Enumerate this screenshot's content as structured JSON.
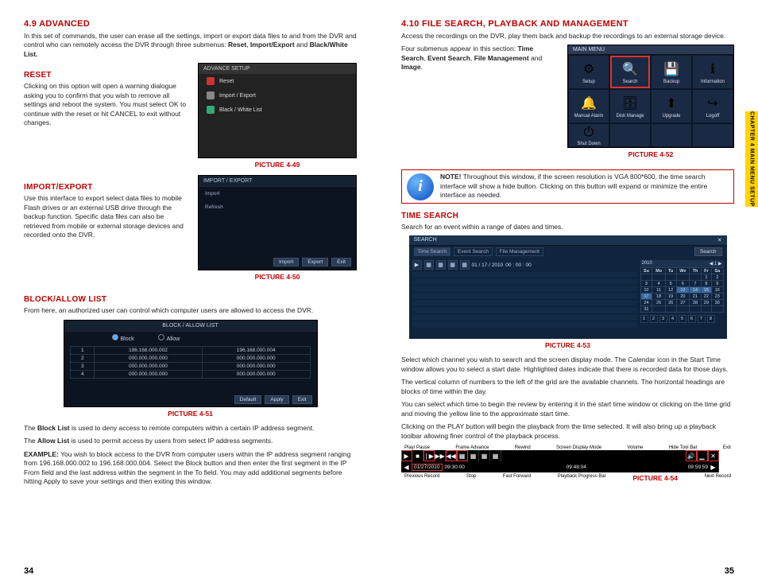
{
  "left": {
    "h1": "4.9 ADVANCED",
    "intro1": "In this set of commands, the user can erase all the settings, import or export data files to and from the DVR and control who can remotely access the DVR through three submenus:",
    "intro2_prefix": "Reset",
    "intro2_sep1": ", ",
    "intro2_mid": "Import/Export",
    "intro2_sep2": " and ",
    "intro2_suffix": "Black/White List.",
    "reset_h": "RESET",
    "reset_p": "Clicking on this option will open a warning dialogue asking you to confirm that you wish to remove all settings and reboot the system. You must select OK to continue with the reset or hit CANCEL to exit without changes.",
    "fig49": {
      "title": "ADVANCE SETUP",
      "items": [
        "Reset",
        "Import / Export",
        "Black / White List"
      ],
      "caption": "PICTURE 4-49"
    },
    "impexp_h": "IMPORT/EXPORT",
    "impexp_p": "Use this interface to export select data files to mobile Flash drives or an external USB drive through the backup function. Specific data files can also be retrieved from mobile or external storage devices and recorded onto the DVR.",
    "fig50": {
      "title": "IMPORT / EXPORT",
      "row1": "Import",
      "row2": "Refresh",
      "btns": [
        "Import",
        "Export",
        "Exit"
      ],
      "caption": "PICTURE 4-50"
    },
    "block_h": "BLOCK/ALLOW LIST",
    "block_p1": "From here, an authorized user can control which computer users are allowed to access the DVR.",
    "fig51": {
      "title": "BLOCK / ALLOW LIST",
      "radio1": "Block",
      "radio2": "Allow",
      "rows": [
        [
          "1",
          "196.168.000.002",
          "196.168.000.004"
        ],
        [
          "2",
          "000.000.000.000",
          "000.000.000.000"
        ],
        [
          "3",
          "000.000.000.000",
          "000.000.000.000"
        ],
        [
          "4",
          "000.000.000.000",
          "000.000.000.000"
        ]
      ],
      "btns": [
        "Default",
        "Apply",
        "Exit"
      ],
      "caption": "PICTURE 4-51"
    },
    "block_p2a": "The ",
    "block_p2b": "Block List",
    "block_p2c": " is used to deny access to remote computers within a certain IP address segment.",
    "block_p3a": "The ",
    "block_p3b": "Allow List",
    "block_p3c": " is used to permit access by users from select IP address segments.",
    "example_label": "EXAMPLE:",
    "example_body": " You wish to block access to the DVR from computer users within the IP address segment ranging from 196.168.000.002 to 196.168.000.004. Select the Block button and then enter the first segment in the IP From field and the last address within the segment in the To field. You may add additional segments before hitting Apply to save your settings and then exiting this window.",
    "page_num": "34"
  },
  "right": {
    "h1": "4.10 FILE SEARCH, PLAYBACK AND MANAGEMENT",
    "intro": "Access the recordings on the DVR, play them back and backup the recordings to an external storage device.",
    "sub_p1a": "Four submenus appear in this section: ",
    "sub_p1_items": [
      "Time Search",
      "Event Search",
      "File Management",
      "Image"
    ],
    "sub_p1_and": " and ",
    "fig52": {
      "title": "MAIN MENU",
      "cells": [
        {
          "label": "Setup",
          "glyph": "⚙"
        },
        {
          "label": "Search",
          "glyph": "🔍",
          "selected": true
        },
        {
          "label": "Backup",
          "glyph": "💾"
        },
        {
          "label": "Information",
          "glyph": "ℹ"
        },
        {
          "label": "Manual Alarm",
          "glyph": "🔔"
        },
        {
          "label": "Disk Manage",
          "glyph": "🗄"
        },
        {
          "label": "Upgrade",
          "glyph": "⬆"
        },
        {
          "label": "Logoff",
          "glyph": "↪"
        }
      ],
      "bottom": {
        "label": "Shut Down",
        "glyph": "⏻"
      },
      "caption": "PICTURE 4-52"
    },
    "note_label": "NOTE!",
    "note_body": " Throughout this window, if the screen resolution is VGA 800*600, the time search interface will show a hide button. Clicking on this button will expand or minimize the entire interface as needed.",
    "ts_h": "TIME SEARCH",
    "ts_p": "Search for an event within a range of dates and times.",
    "fig53": {
      "title": "SEARCH",
      "tabs": [
        "Time Search",
        "Event Search",
        "File Management"
      ],
      "search_btn": "Search",
      "start_time_date": "01 / 17 / 2010",
      "start_time_time": "00 : 00 : 00",
      "cal_month": "2010",
      "cal_nav": "◀ 1 ▶",
      "days_hdr": [
        "Su",
        "Mo",
        "Tu",
        "We",
        "Th",
        "Fr",
        "Sa"
      ],
      "cal_rows": [
        [
          "",
          "",
          "",
          "",
          "",
          "1",
          "2"
        ],
        [
          "3",
          "4",
          "5",
          "6",
          "7",
          "8",
          "9"
        ],
        [
          "10",
          "11",
          "12",
          "13",
          "14",
          "15",
          "16"
        ],
        [
          "17",
          "18",
          "19",
          "20",
          "21",
          "22",
          "23"
        ],
        [
          "24",
          "25",
          "26",
          "27",
          "28",
          "29",
          "30"
        ],
        [
          "31",
          "",
          "",
          "",
          "",
          "",
          ""
        ]
      ],
      "checks": [
        "1",
        "2",
        "3",
        "4",
        "5",
        "6",
        "7",
        "8"
      ],
      "caption": "PICTURE 4-53"
    },
    "ts_p2": "Select which channel you wish to search and the screen display mode. The Calendar icon in the Start Time window allows you to select a start date. Highlighted dates indicate that there is recorded data for those days.",
    "ts_p3": "The vertical column of numbers to the left of the grid are the available channels. The horizontal headings are blocks of time within the day.",
    "ts_p4": "You can select which time to begin the review by entering it in the start time window or clicking on the time grid and moving the yellow line to the approximate start time.",
    "ts_p5": "Clicking on the PLAY button will begin the playback from the time selected. It will also bring up a playback toolbar allowing finer control of the playback process.",
    "fig54": {
      "top_labels": [
        "Play/\nPause",
        "Frame\nAdvance",
        "Rewind",
        "Screen Display\nMode",
        "Volume",
        "Hide\nTool Bar",
        "Exit"
      ],
      "date": "01/27/2010",
      "t1": "09:30:00",
      "t2": "09:48:04",
      "t3": "09:59:59",
      "bot_labels": [
        "Previous\nRecord",
        "Stop",
        "Fast\nForward",
        "Playback\nProgress Bar",
        "Next\nRecord"
      ],
      "caption": "PICTURE 4-54"
    },
    "page_num": "35",
    "side_tab": "CHAPTER 4  MAIN MENU SETUP"
  }
}
